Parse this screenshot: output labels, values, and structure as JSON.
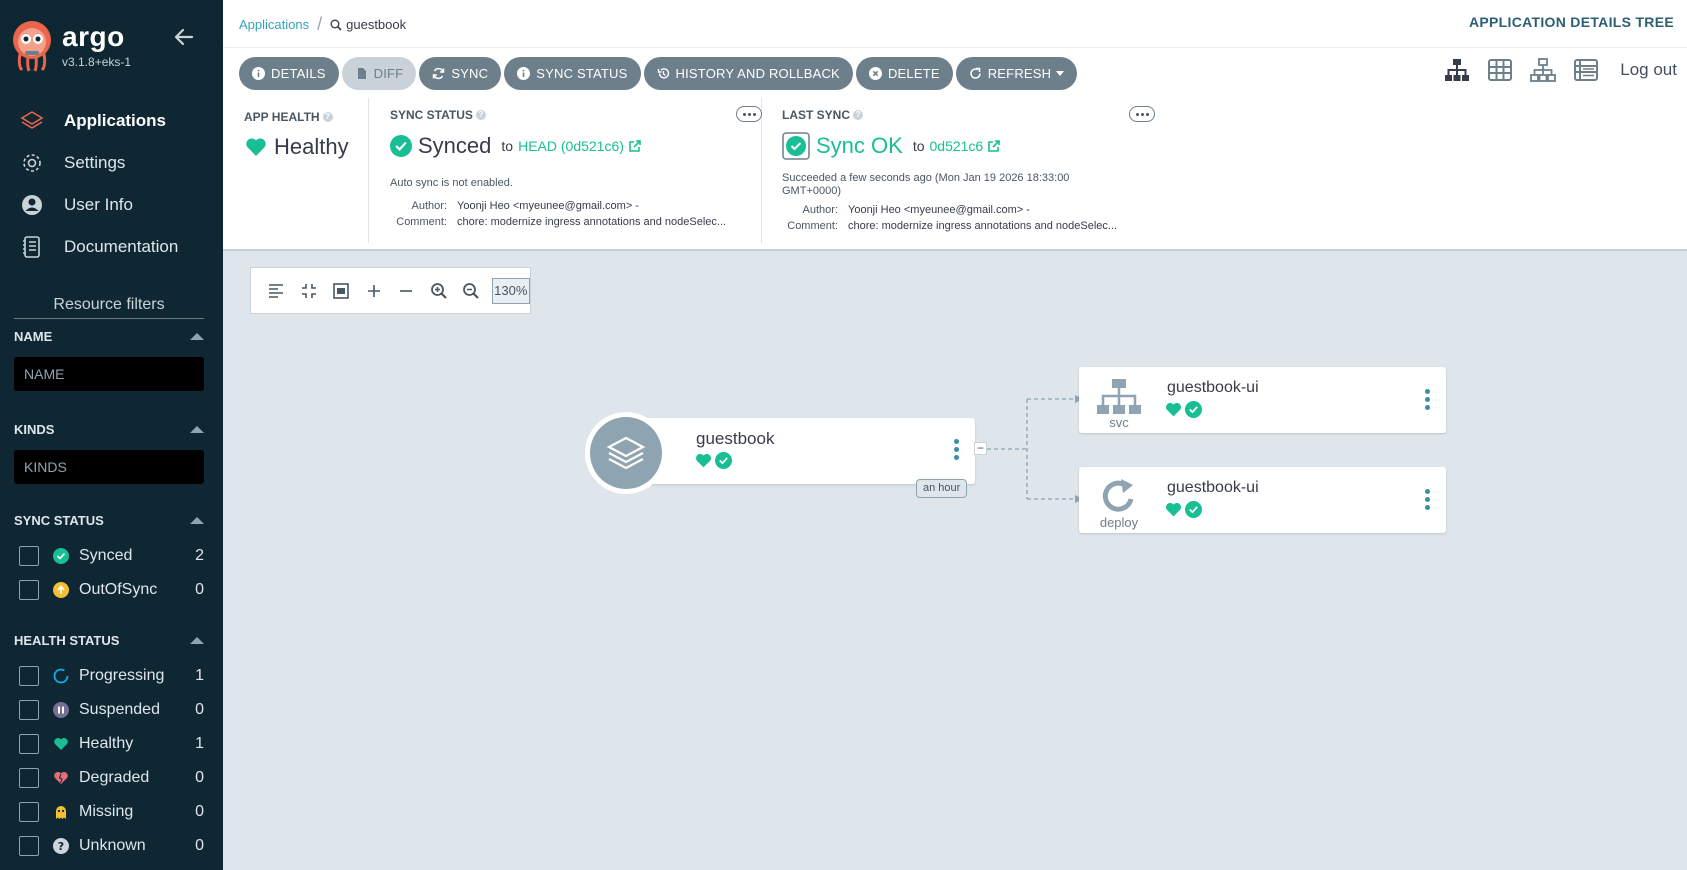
{
  "sidebar": {
    "brand": "argo",
    "version": "v3.1.8+eks-1",
    "nav": [
      {
        "label": "Applications",
        "icon": "stack-icon"
      },
      {
        "label": "Settings",
        "icon": "gear-icon"
      },
      {
        "label": "User Info",
        "icon": "user-icon"
      },
      {
        "label": "Documentation",
        "icon": "book-icon"
      }
    ],
    "filters_title": "Resource filters",
    "name_filter": {
      "title": "NAME",
      "placeholder": "NAME"
    },
    "kinds_filter": {
      "title": "KINDS",
      "placeholder": "KINDS"
    },
    "sync_status": {
      "title": "SYNC STATUS",
      "items": [
        {
          "label": "Synced",
          "count": "2",
          "color": "#18be94"
        },
        {
          "label": "OutOfSync",
          "count": "0",
          "color": "#f4c030"
        }
      ]
    },
    "health_status": {
      "title": "HEALTH STATUS",
      "items": [
        {
          "label": "Progressing",
          "count": "1",
          "color": "#0dadea"
        },
        {
          "label": "Suspended",
          "count": "0",
          "color": "#766f94"
        },
        {
          "label": "Healthy",
          "count": "1",
          "color": "#18be94"
        },
        {
          "label": "Degraded",
          "count": "0",
          "color": "#e96d76"
        },
        {
          "label": "Missing",
          "count": "0",
          "color": "#f4c030"
        },
        {
          "label": "Unknown",
          "count": "0",
          "color": "#ccd6dd"
        }
      ]
    }
  },
  "topbar": {
    "breadcrumb_root": "Applications",
    "breadcrumb_current": "guestbook",
    "page_title": "APPLICATION DETAILS TREE"
  },
  "actions": {
    "details": "DETAILS",
    "diff": "DIFF",
    "sync": "SYNC",
    "sync_status": "SYNC STATUS",
    "history": "HISTORY AND ROLLBACK",
    "delete": "DELETE",
    "refresh": "REFRESH",
    "logout": "Log out"
  },
  "status": {
    "app_health": {
      "title": "APP HEALTH",
      "value": "Healthy"
    },
    "sync_status": {
      "title": "SYNC STATUS",
      "value": "Synced",
      "to": "to",
      "revision": "HEAD (0d521c6)",
      "note": "Auto sync is not enabled.",
      "author_label": "Author:",
      "author": "Yoonji Heo <myeunee@gmail.com> -",
      "comment_label": "Comment:",
      "comment": "chore: modernize ingress annotations and nodeSelec..."
    },
    "last_sync": {
      "title": "LAST SYNC",
      "value": "Sync OK",
      "to": "to",
      "revision": "0d521c6",
      "note_line1": "Succeeded a few seconds ago (Mon Jan 19 2026 18:33:00",
      "note_line2": "GMT+0000)",
      "author_label": "Author:",
      "author": "Yoonji Heo <myeunee@gmail.com> -",
      "comment_label": "Comment:",
      "comment": "chore: modernize ingress annotations and nodeSelec..."
    }
  },
  "canvas": {
    "zoom": "130%",
    "app_node": {
      "name": "guestbook",
      "age": "an hour"
    },
    "resources": [
      {
        "name": "guestbook-ui",
        "kind": "svc"
      },
      {
        "name": "guestbook-ui",
        "kind": "deploy"
      }
    ]
  },
  "colors": {
    "accent": "#18be94",
    "sidebar": "#0f2733",
    "button": "#6d7f8b"
  }
}
